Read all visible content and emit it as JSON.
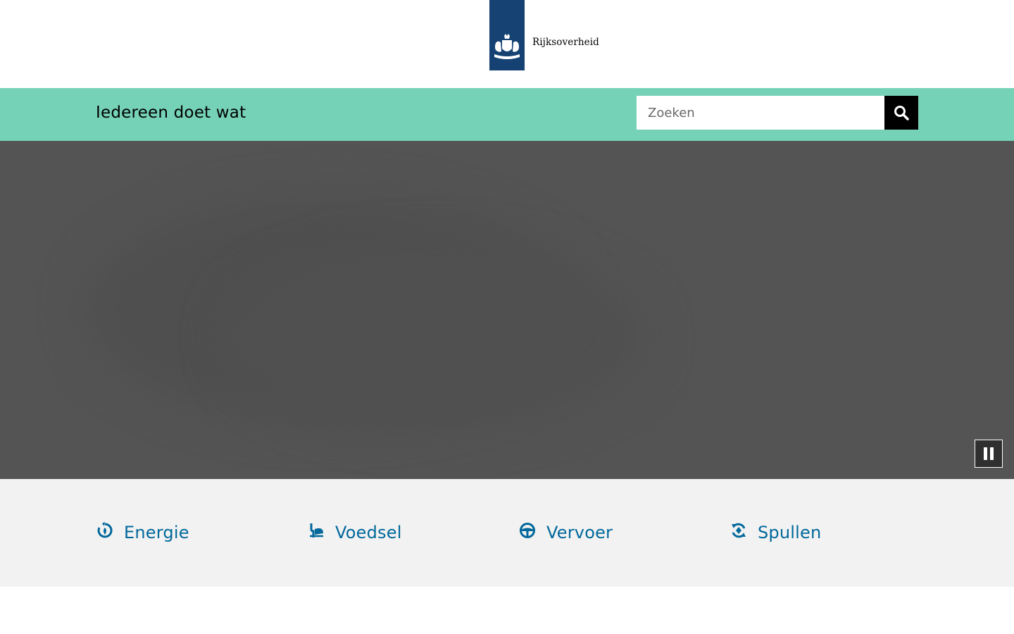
{
  "logo": {
    "text": "Rijksoverheid",
    "ribbon_color": "#154273",
    "icon": "coat-of-arms-icon"
  },
  "header": {
    "site_title": "Iedereen doet wat",
    "bar_color": "#76d2b6",
    "search": {
      "placeholder": "Zoeken",
      "value": "",
      "button_icon": "search-icon"
    }
  },
  "hero": {
    "background_color": "#545454",
    "pause_icon": "pause-icon"
  },
  "themes": {
    "link_color": "#01689b",
    "items": [
      {
        "label": "Energie",
        "icon": "energy-icon"
      },
      {
        "label": "Voedsel",
        "icon": "food-icon"
      },
      {
        "label": "Vervoer",
        "icon": "steering-wheel-icon"
      },
      {
        "label": "Spullen",
        "icon": "recycle-icon"
      }
    ]
  }
}
